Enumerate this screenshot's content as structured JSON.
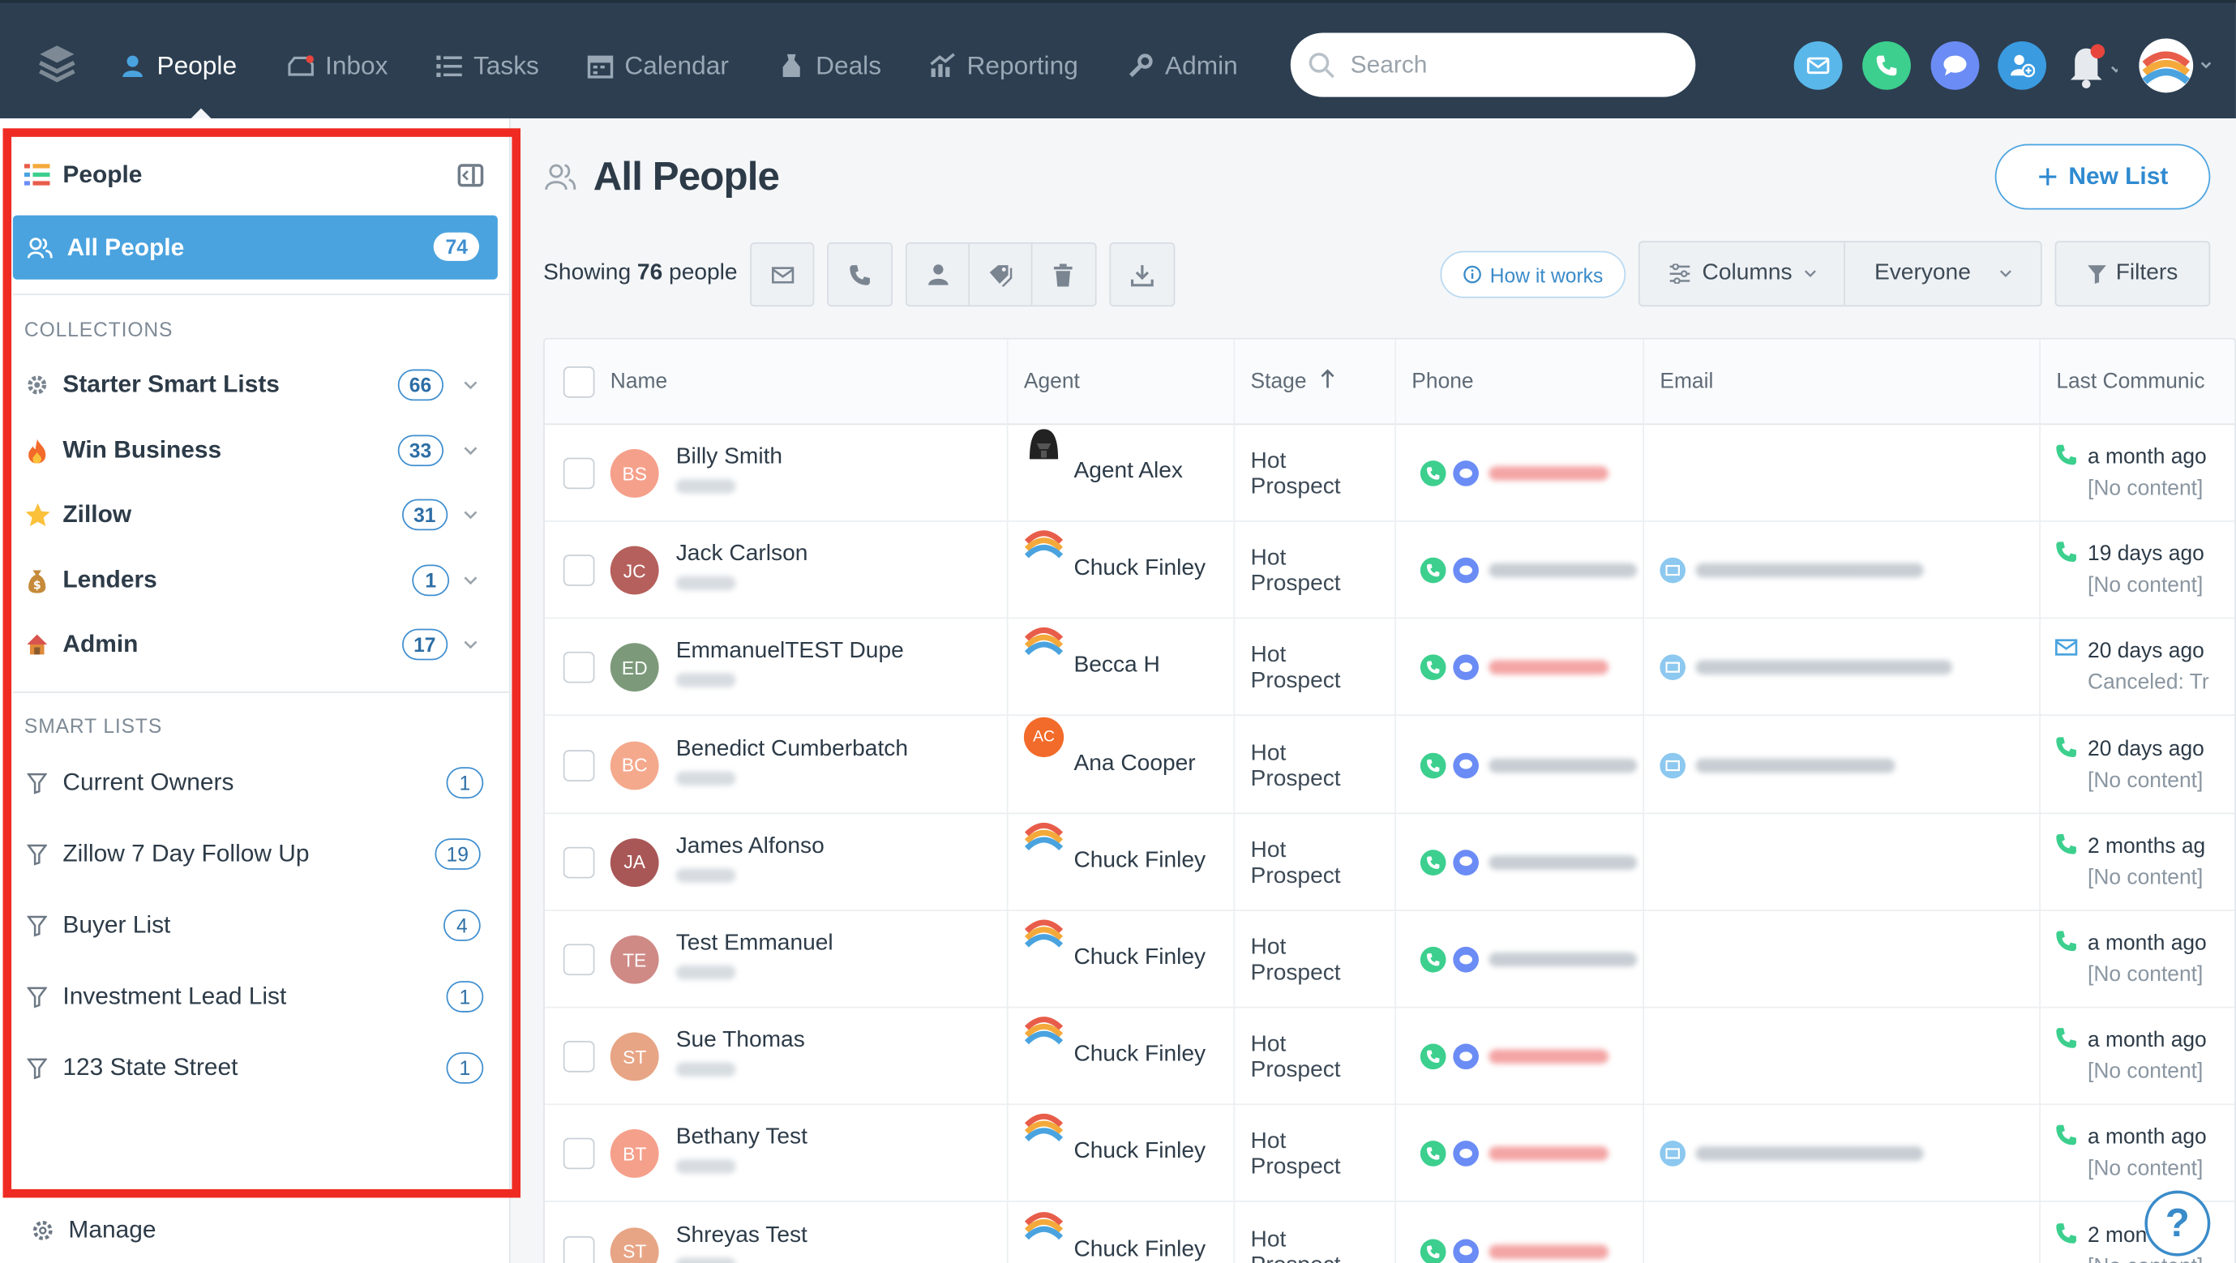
{
  "nav": {
    "items": [
      {
        "label": "People",
        "icon": "people-icon",
        "active": true
      },
      {
        "label": "Inbox",
        "icon": "inbox-icon"
      },
      {
        "label": "Tasks",
        "icon": "tasks-icon"
      },
      {
        "label": "Calendar",
        "icon": "calendar-icon"
      },
      {
        "label": "Deals",
        "icon": "deals-icon"
      },
      {
        "label": "Reporting",
        "icon": "reporting-icon"
      },
      {
        "label": "Admin",
        "icon": "wrench-icon"
      }
    ],
    "search_placeholder": "Search",
    "action_colors": {
      "email": "#5ab7ea",
      "call": "#3ccf8e",
      "chat": "#6b8cf5",
      "add_contact": "#3a9be0"
    }
  },
  "sidebar": {
    "title": "People",
    "all_people": {
      "label": "All People",
      "count": "74"
    },
    "collections_label": "COLLECTIONS",
    "collections": [
      {
        "label": "Starter Smart Lists",
        "count": "66",
        "icon": "gear-icon"
      },
      {
        "label": "Win Business",
        "count": "33",
        "icon": "fire-icon"
      },
      {
        "label": "Zillow",
        "count": "31",
        "icon": "star-icon"
      },
      {
        "label": "Lenders",
        "count": "1",
        "icon": "money-bag-icon"
      },
      {
        "label": "Admin",
        "count": "17",
        "icon": "house-icon"
      }
    ],
    "smart_lists_label": "SMART LISTS",
    "smart_lists": [
      {
        "label": "Current Owners",
        "count": "1"
      },
      {
        "label": "Zillow 7 Day Follow Up",
        "count": "19"
      },
      {
        "label": "Buyer List",
        "count": "4"
      },
      {
        "label": "Investment Lead List",
        "count": "1"
      },
      {
        "label": "123 State Street",
        "count": "1"
      }
    ],
    "manage_label": "Manage"
  },
  "main": {
    "title": "All People",
    "new_list_label": "New List",
    "showing_prefix": "Showing ",
    "showing_count": "76",
    "showing_suffix": " people",
    "how_it_works": "How it works",
    "columns_label": "Columns",
    "everyone_label": "Everyone",
    "filters_label": "Filters"
  },
  "table": {
    "headers": [
      "Name",
      "Agent",
      "Stage",
      "Phone",
      "Email",
      "Last Communic"
    ],
    "rows": [
      {
        "initials": "BS",
        "avatar_color": "#f5a08b",
        "name": "Billy Smith",
        "agent": "Agent Alex",
        "agent_icon": "darth-vader-avatar",
        "stage1": "Hot",
        "stage2": "Prospect",
        "phone_color": "#f4a5a5",
        "has_email": false,
        "lc_icon": "phone",
        "lc_top": "a month ago",
        "lc_bot": "[No content]"
      },
      {
        "initials": "JC",
        "avatar_color": "#b5605c",
        "name": "Jack Carlson",
        "agent": "Chuck Finley",
        "agent_icon": "rainbow-avatar",
        "stage1": "Hot",
        "stage2": "Prospect",
        "phone_color": "#c7cdd3",
        "has_email": true,
        "lc_icon": "phone",
        "lc_top": "19 days ago",
        "lc_bot": "[No content]"
      },
      {
        "initials": "ED",
        "avatar_color": "#7c9a7a",
        "name": "EmmanuelTEST Dupe",
        "agent": "Becca H",
        "agent_icon": "rainbow-avatar",
        "stage1": "Hot",
        "stage2": "Prospect",
        "phone_color": "#f4a5a5",
        "has_email": true,
        "lc_icon": "email",
        "lc_top": "20 days ago",
        "lc_bot": "Canceled: Tr"
      },
      {
        "initials": "BC",
        "avatar_color": "#f4a98d",
        "name": "Benedict Cumberbatch",
        "agent": "Ana Cooper",
        "agent_icon": "ac-avatar",
        "stage1": "Hot",
        "stage2": "Prospect",
        "phone_color": "#c7cdd3",
        "has_email": true,
        "lc_icon": "phone",
        "lc_top": "20 days ago",
        "lc_bot": "[No content]"
      },
      {
        "initials": "JA",
        "avatar_color": "#a85756",
        "name": "James Alfonso",
        "agent": "Chuck Finley",
        "agent_icon": "rainbow-avatar",
        "stage1": "Hot",
        "stage2": "Prospect",
        "phone_color": "#c7cdd3",
        "has_email": false,
        "lc_icon": "phone",
        "lc_top": "2 months ag",
        "lc_bot": "[No content]"
      },
      {
        "initials": "TE",
        "avatar_color": "#cf8a86",
        "name": "Test Emmanuel",
        "agent": "Chuck Finley",
        "agent_icon": "rainbow-avatar",
        "stage1": "Hot",
        "stage2": "Prospect",
        "phone_color": "#c7cdd3",
        "has_email": false,
        "lc_icon": "phone",
        "lc_top": "a month ago",
        "lc_bot": "[No content]"
      },
      {
        "initials": "ST",
        "avatar_color": "#e7a585",
        "name": "Sue Thomas",
        "agent": "Chuck Finley",
        "agent_icon": "rainbow-avatar",
        "stage1": "Hot",
        "stage2": "Prospect",
        "phone_color": "#f4a5a5",
        "has_email": false,
        "lc_icon": "phone",
        "lc_top": "a month ago",
        "lc_bot": "[No content]"
      },
      {
        "initials": "BT",
        "avatar_color": "#f5a08b",
        "name": "Bethany Test",
        "agent": "Chuck Finley",
        "agent_icon": "rainbow-avatar",
        "stage1": "Hot",
        "stage2": "Prospect",
        "phone_color": "#f4a5a5",
        "has_email": true,
        "lc_icon": "phone",
        "lc_top": "a month ago",
        "lc_bot": "[No content]"
      },
      {
        "initials": "ST",
        "avatar_color": "#e7a585",
        "name": "Shreyas Test",
        "agent": "Chuck Finley",
        "agent_icon": "rainbow-avatar",
        "stage1": "Hot",
        "stage2": "Prospect",
        "phone_color": "#f4a5a5",
        "has_email": false,
        "lc_icon": "phone",
        "lc_top": "2 mon",
        "lc_bot": "[No content]"
      }
    ]
  },
  "help_label": "?"
}
